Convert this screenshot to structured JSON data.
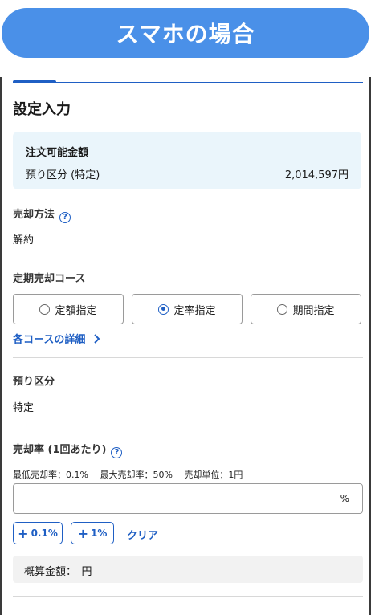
{
  "banner": {
    "text": "スマホの場合"
  },
  "section_title": "設定入力",
  "order_amount": {
    "title": "注文可能金額",
    "label": "預り区分 (特定)",
    "value": "2,014,597円"
  },
  "sell_method": {
    "label": "売却方法",
    "value": "解約"
  },
  "course": {
    "label": "定期売却コース",
    "options": [
      "定額指定",
      "定率指定",
      "期間指定"
    ],
    "selected": "定率指定",
    "details_link": "各コースの詳細"
  },
  "custody": {
    "label": "預り区分",
    "value": "特定"
  },
  "rate": {
    "label": "売却率 (1回あたり)",
    "note": "最低売却率：0.1%　 最大売却率：50%　 売却単位：1円",
    "input_value": "",
    "unit": "%",
    "step_buttons": [
      "0.1%",
      "1%"
    ],
    "clear_label": "クリア"
  },
  "estimate": {
    "text": "概算金額：–円"
  },
  "help_glyph": "?",
  "colors": {
    "accent": "#1f5fc4",
    "banner": "#4a90e8",
    "info_bg": "#eaf5fb"
  }
}
